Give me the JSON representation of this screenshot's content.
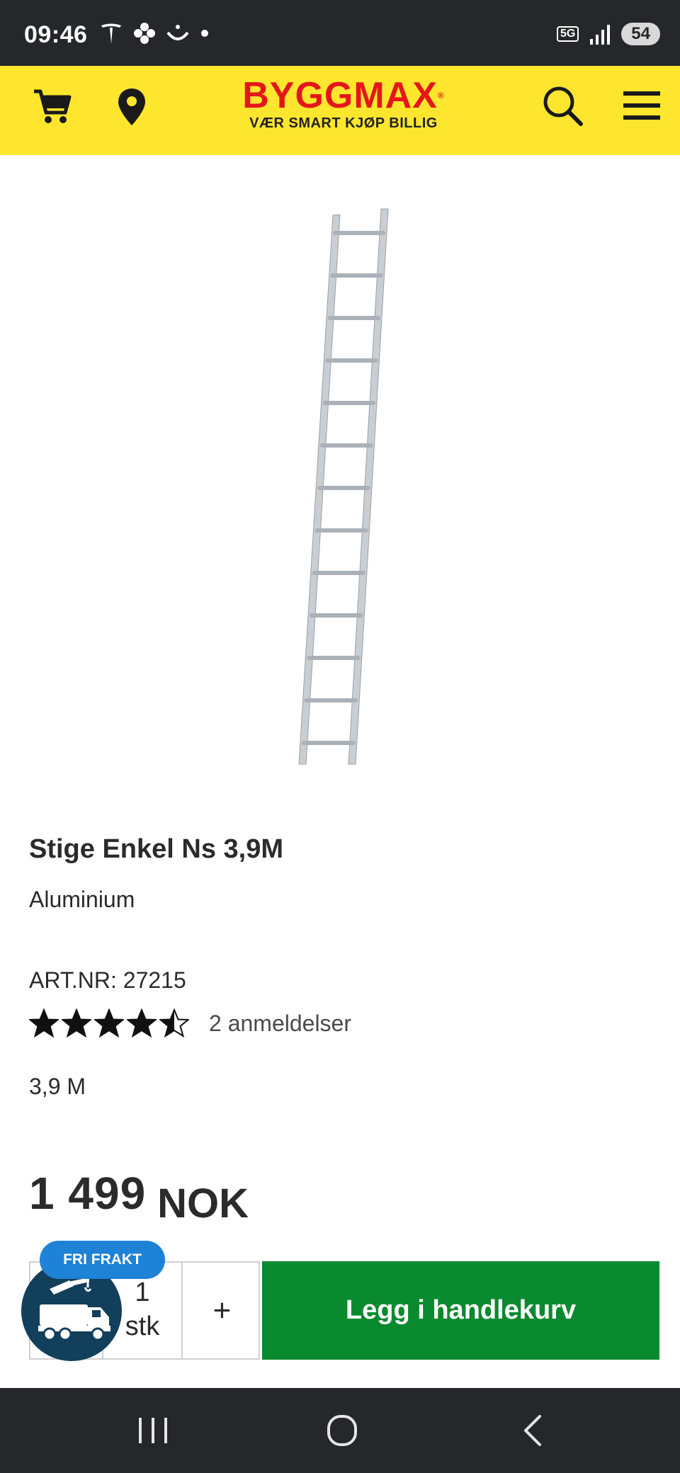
{
  "status_bar": {
    "time": "09:46",
    "left_icons": [
      "tesla-icon",
      "flower-icon",
      "smile-icon",
      "dot-icon"
    ],
    "network": "5G",
    "battery": "54"
  },
  "header": {
    "brand": "BYGGMAX",
    "tagline": "VÆR SMART KJØP BILLIG",
    "icons": [
      "cart-icon",
      "location-pin-icon",
      "search-icon",
      "menu-icon"
    ],
    "colors": {
      "background": "#ffe62e",
      "brand": "#e3171b"
    }
  },
  "product": {
    "title": "Stige Enkel Ns 3,9M",
    "material": "Aluminium",
    "art_nr": "ART.NR: 27215",
    "rating": 4.5,
    "rating_max": 5,
    "reviews": "2 anmeldelser",
    "size": "3,9 M",
    "price_amount": "1 499",
    "price_currency": "NOK"
  },
  "purchase": {
    "qty_value": "1",
    "qty_unit": "stk",
    "plus_label": "+",
    "add_to_cart": "Legg i handlekurv",
    "badge": "FRI FRAKT",
    "colors": {
      "add_to_cart": "#0a8a2e",
      "badge": "#1e82d6",
      "truck_badge": "#123f5c"
    }
  },
  "nav_bar": {
    "buttons": [
      "recent-apps-icon",
      "home-icon",
      "back-icon"
    ]
  }
}
